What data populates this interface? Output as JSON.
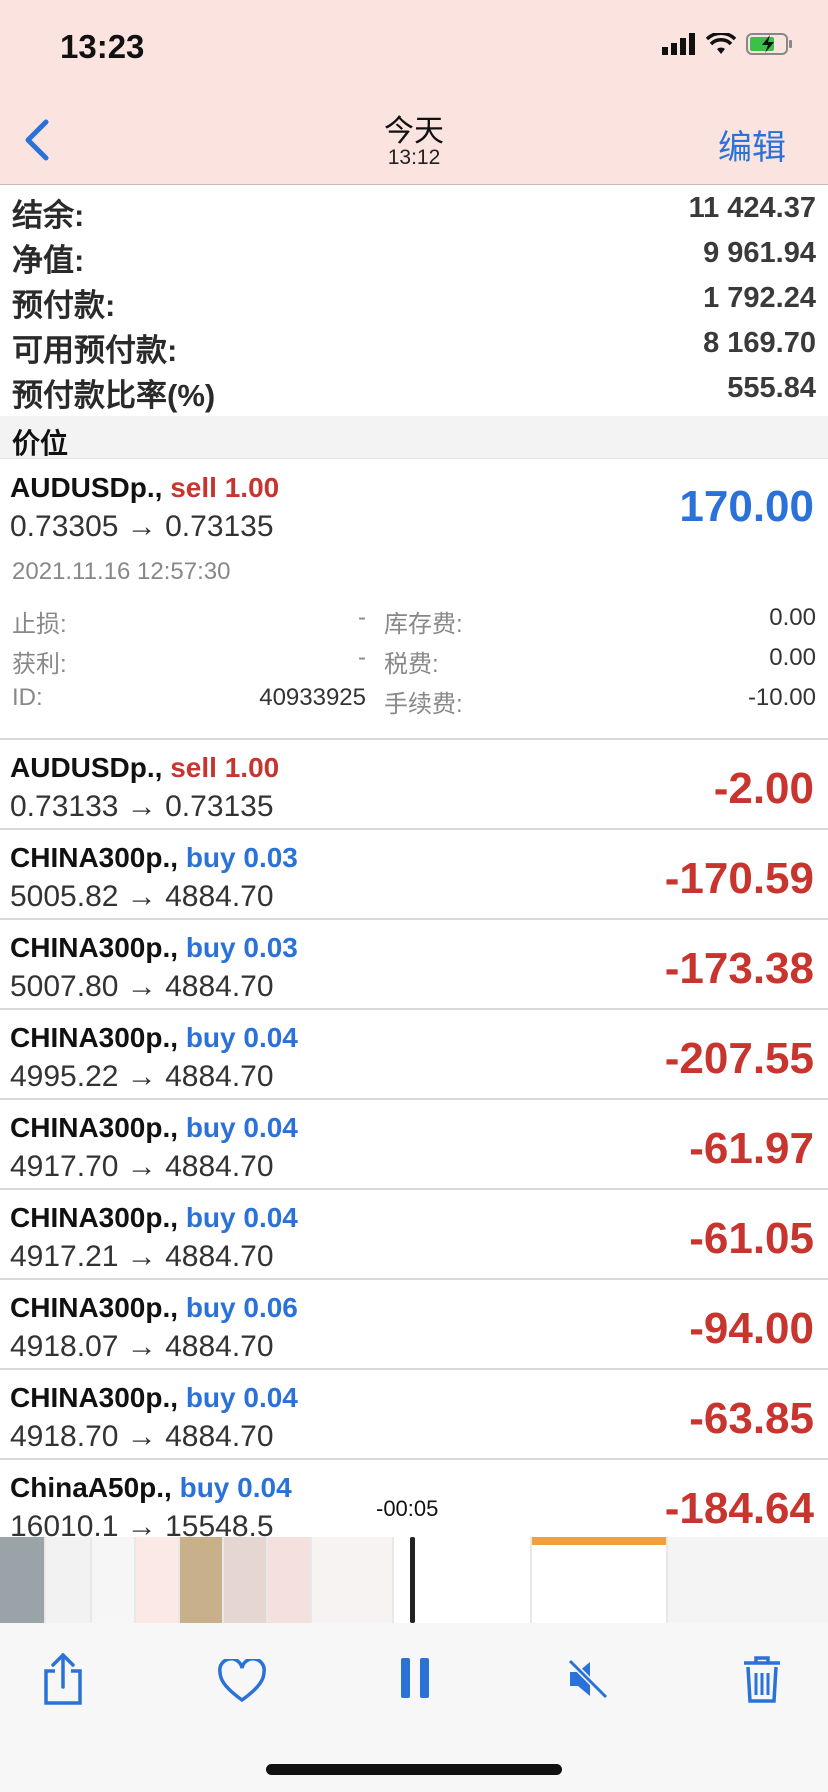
{
  "status": {
    "time": "13:23"
  },
  "nav": {
    "title": "今天",
    "subtitle": "13:12",
    "edit_label": "编辑"
  },
  "summary": [
    {
      "label": "结余:",
      "value": "11 424.37"
    },
    {
      "label": "净值:",
      "value": "9 961.94"
    },
    {
      "label": "预付款:",
      "value": "1 792.24"
    },
    {
      "label": "可用预付款:",
      "value": "8 169.70"
    },
    {
      "label": "预付款比率(%)",
      "value": "555.84"
    }
  ],
  "section": {
    "title": "价位"
  },
  "expanded": {
    "symbol": "AUDUSDp.,",
    "side": "sell 1.00",
    "prices": "0.73305 → 0.73135",
    "profit": "170.00",
    "datetime": "2021.11.16 12:57:30",
    "stop_loss_label": "止损:",
    "stop_loss_value": "-",
    "swap_label": "库存费:",
    "swap_value": "0.00",
    "take_profit_label": "获利:",
    "take_profit_value": "-",
    "tax_label": "税费:",
    "tax_value": "0.00",
    "id_label": "ID:",
    "id_value": "40933925",
    "commission_label": "手续费:",
    "commission_value": "-10.00"
  },
  "positions": [
    {
      "symbol": "AUDUSDp.,",
      "side": "sell 1.00",
      "prices": "0.73133 → 0.73135",
      "profit": "-2.00"
    },
    {
      "symbol": "CHINA300p.,",
      "side": "buy 0.03",
      "prices": "5005.82 → 4884.70",
      "profit": "-170.59"
    },
    {
      "symbol": "CHINA300p.,",
      "side": "buy 0.03",
      "prices": "5007.80 → 4884.70",
      "profit": "-173.38"
    },
    {
      "symbol": "CHINA300p.,",
      "side": "buy 0.04",
      "prices": "4995.22 → 4884.70",
      "profit": "-207.55"
    },
    {
      "symbol": "CHINA300p.,",
      "side": "buy 0.04",
      "prices": "4917.70 → 4884.70",
      "profit": "-61.97"
    },
    {
      "symbol": "CHINA300p.,",
      "side": "buy 0.04",
      "prices": "4917.21 → 4884.70",
      "profit": "-61.05"
    },
    {
      "symbol": "CHINA300p.,",
      "side": "buy 0.06",
      "prices": "4918.07 → 4884.70",
      "profit": "-94.00"
    },
    {
      "symbol": "CHINA300p.,",
      "side": "buy 0.04",
      "prices": "4918.70 → 4884.70",
      "profit": "-63.85"
    },
    {
      "symbol": "ChinaA50p.,",
      "side": "buy 0.04",
      "prices": "16010.1 → 15548.5",
      "profit": "-184.64"
    }
  ],
  "player": {
    "timecode": "-00:05"
  },
  "toolbar": {
    "share_icon": "share-icon",
    "like_icon": "heart-icon",
    "pause_icon": "pause-icon",
    "mute_icon": "speaker-muted-icon",
    "delete_icon": "trash-icon"
  },
  "colors": {
    "accent": "#2a72d8",
    "loss": "#c7352e",
    "header_bg": "#fbe3df"
  }
}
